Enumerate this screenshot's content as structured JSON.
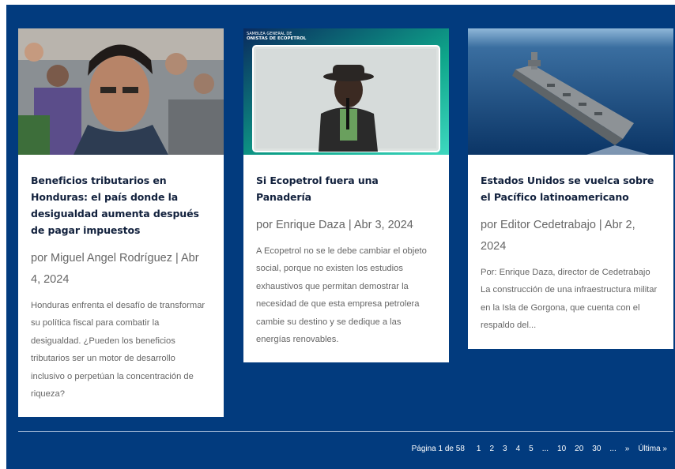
{
  "posts": [
    {
      "title": "Beneficios tributarios en Honduras: el país donde la desigualdad aumenta después de pagar impuestos",
      "meta": "por Miguel Angel Rodríguez | Abr 4, 2024",
      "excerpt": "Honduras enfrenta el desafío de transformar su política fiscal para combatir la desigualdad. ¿Pueden los beneficios tributarios ser un motor de desarrollo inclusivo o perpetúan la concentración de riqueza?"
    },
    {
      "title": "Si Ecopetrol fuera una Panadería",
      "meta": "por Enrique Daza | Abr 3, 2024",
      "excerpt": "A Ecopetrol no se le debe cambiar el objeto social, porque no existen los estudios exhaustivos que permitan demostrar la necesidad de que esta empresa petrolera cambie su destino y se dedique a las energías renovables.",
      "image_caption_line1": "SAMBLEA GENERAL DE",
      "image_caption_line2": "ONISTAS DE ECOPETROL"
    },
    {
      "title": "Estados Unidos se vuelca sobre el Pacífico latinoamericano",
      "meta": "por Editor Cedetrabajo | Abr 2, 2024",
      "excerpt": "Por: Enrique Daza, director de Cedetrabajo La construcción de una infraestructura militar en la Isla de Gorgona, que cuenta con el respaldo del..."
    }
  ],
  "pagination": {
    "label": "Página 1 de 58",
    "pages": [
      "1",
      "2",
      "3",
      "4",
      "5",
      "...",
      "10",
      "20",
      "30",
      "...",
      "»",
      "Última »"
    ]
  },
  "colors": {
    "background": "#023b7e",
    "card": "#ffffff",
    "title": "#12213d",
    "meta": "#666666"
  }
}
